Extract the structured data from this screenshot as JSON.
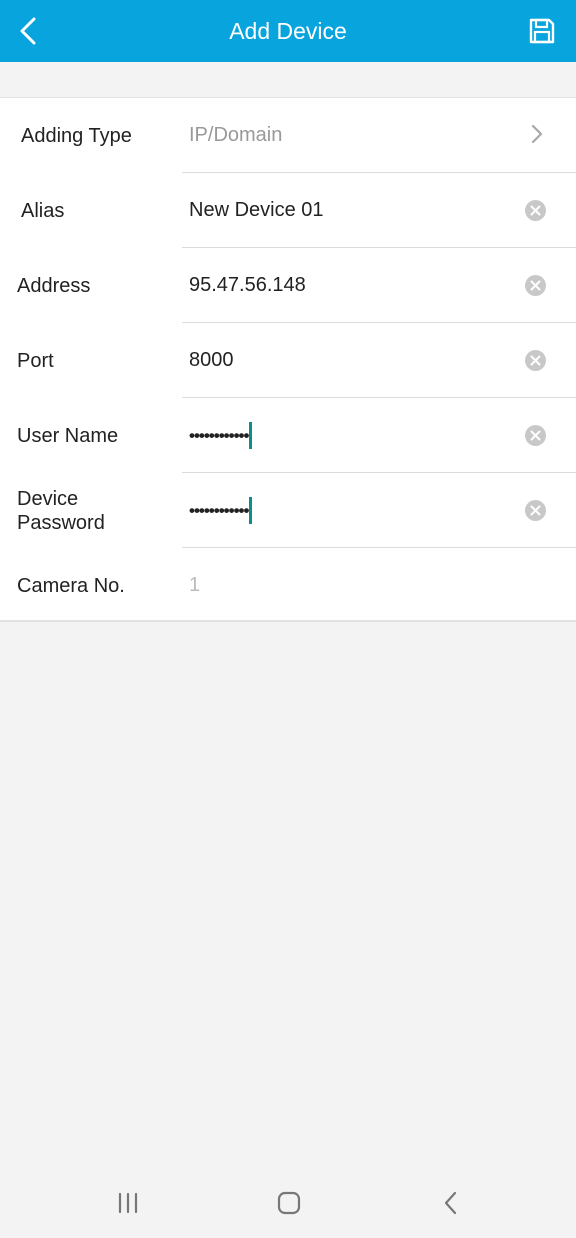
{
  "header": {
    "title": "Add Device",
    "back_icon": "chevron-left-icon",
    "save_icon": "floppy-disk-icon"
  },
  "form": {
    "adding_type": {
      "label": "Adding Type",
      "value": "IP/Domain"
    },
    "alias": {
      "label": "Alias",
      "value": "New Device 01"
    },
    "address": {
      "label": "Address",
      "value": "95.47.56.148"
    },
    "port": {
      "label": "Port",
      "value": "8000"
    },
    "user_name": {
      "label": "User Name",
      "value": "••••••••••••"
    },
    "device_password": {
      "label": "Device Password",
      "value": "••••••••••••"
    },
    "camera_no": {
      "label": "Camera No.",
      "value": "1"
    }
  },
  "navbar": {
    "recents_icon": "recents-icon",
    "home_icon": "home-icon",
    "back_icon": "back-icon"
  },
  "colors": {
    "header_bg": "#08a4de",
    "cursor": "#0a8f8f",
    "page_bg": "#f3f3f3"
  }
}
